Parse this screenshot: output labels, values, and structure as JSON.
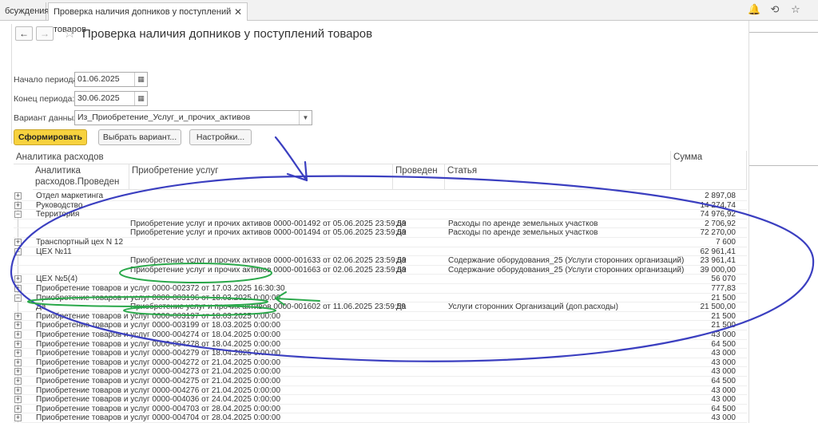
{
  "tabs": [
    {
      "label": "бсуждения"
    },
    {
      "label": "Проверка наличия допников у поступлений товаров"
    }
  ],
  "icons": {
    "bell": "bell-icon",
    "history": "history-icon",
    "star": "star-icon",
    "close": "close-icon"
  },
  "nav": {
    "back": "←",
    "forward": "→"
  },
  "page_title": "Проверка наличия допников у поступлений товаров",
  "form": {
    "start_label": "Начало периода:",
    "start_value": "01.06.2025",
    "end_label": "Конец периода:",
    "end_value": "30.06.2025",
    "variant_label": "Вариант данных:",
    "variant_value": "Из_Приобретение_Услуг_и_прочих_активов"
  },
  "buttons": {
    "generate": "Сформировать",
    "choose_variant": "Выбрать вариант...",
    "settings": "Настройки..."
  },
  "report": {
    "headers": {
      "group": "Аналитика расходов",
      "sum": "Сумма",
      "col0": "Аналитика расходов.Проведен",
      "col1": "Приобретение услуг",
      "col2": "Проведен",
      "col3": "Статья"
    },
    "rows": [
      {
        "exp": "+",
        "c0": "Отдел маркетинга",
        "c1": "",
        "c2": "",
        "c3": "",
        "sum": "2 897,08"
      },
      {
        "exp": "+",
        "c0": "Руководство",
        "c1": "",
        "c2": "",
        "c3": "",
        "sum": "14 274,74"
      },
      {
        "exp": "−",
        "c0": "Территория",
        "c1": "",
        "c2": "",
        "c3": "",
        "sum": "74 976,92"
      },
      {
        "exp": "",
        "c0": "",
        "c1": "Приобретение услуг и прочих активов 0000-001492 от 05.06.2025 23:59:59",
        "c2": "Да",
        "c3": "Расходы по аренде земельных участков",
        "sum": "2 706,92"
      },
      {
        "exp": "",
        "c0": "",
        "c1": "Приобретение услуг и прочих активов 0000-001494 от 05.06.2025 23:59:59",
        "c2": "Да",
        "c3": "Расходы по аренде земельных участков",
        "sum": "72 270,00"
      },
      {
        "exp": "+",
        "c0": "Транспортный цех N 12",
        "c1": "",
        "c2": "",
        "c3": "",
        "sum": "7 600"
      },
      {
        "exp": "−",
        "c0": "ЦЕХ №11",
        "c1": "",
        "c2": "",
        "c3": "",
        "sum": "62 961,41"
      },
      {
        "exp": "",
        "c0": "",
        "c1": "Приобретение услуг и прочих активов 0000-001633 от 02.06.2025 23:59:59",
        "c2": "Да",
        "c3": "Содержание оборудования_25 (Услуги сторонних организаций)",
        "sum": "23 961,41"
      },
      {
        "exp": "",
        "c0": "",
        "c1": "Приобретение услуг и прочих активов 0000-001663 от 02.06.2025 23:59:59",
        "c2": "Да",
        "c3": "Содержание оборудования_25 (Услуги сторонних организаций)",
        "sum": "39 000,00"
      },
      {
        "exp": "+",
        "c0": "ЦЕХ №5(4)",
        "c1": "",
        "c2": "",
        "c3": "",
        "sum": "56 070"
      },
      {
        "exp": "+",
        "c0": "Приобретение товаров и услуг 0000-002372 от 17.03.2025 16:30:30",
        "c1": "",
        "c2": "",
        "c3": "",
        "sum": "777,83"
      },
      {
        "exp": "−",
        "c0": "Приобретение товаров и услуг 0000-003196 от 18.03.2025 0:00:00",
        "c1": "",
        "c2": "",
        "c3": "",
        "sum": "21 500"
      },
      {
        "exp": "",
        "c0": "Да",
        "c1": "Приобретение услуг и прочих активов 0000-001602 от 11.06.2025 23:59:59",
        "c2": "Да",
        "c3": "Услуги сторонних Организаций (доп.расходы)",
        "sum": "21 500,00"
      },
      {
        "exp": "+",
        "c0": "Приобретение товаров и услуг 0000-003197 от 18.03.2025 0:00:00",
        "c1": "",
        "c2": "",
        "c3": "",
        "sum": "21 500"
      },
      {
        "exp": "+",
        "c0": "Приобретение товаров и услуг 0000-003199 от 18.03.2025 0:00:00",
        "c1": "",
        "c2": "",
        "c3": "",
        "sum": "21 500"
      },
      {
        "exp": "+",
        "c0": "Приобретение товаров и услуг 0000-004274 от 18.04.2025 0:00:00",
        "c1": "",
        "c2": "",
        "c3": "",
        "sum": "43 000"
      },
      {
        "exp": "+",
        "c0": "Приобретение товаров и услуг 0000-004278 от 18.04.2025 0:00:00",
        "c1": "",
        "c2": "",
        "c3": "",
        "sum": "64 500"
      },
      {
        "exp": "+",
        "c0": "Приобретение товаров и услуг 0000-004279 от 18.04.2025 0:00:00",
        "c1": "",
        "c2": "",
        "c3": "",
        "sum": "43 000"
      },
      {
        "exp": "+",
        "c0": "Приобретение товаров и услуг 0000-004272 от 21.04.2025 0:00:00",
        "c1": "",
        "c2": "",
        "c3": "",
        "sum": "43 000"
      },
      {
        "exp": "+",
        "c0": "Приобретение товаров и услуг 0000-004273 от 21.04.2025 0:00:00",
        "c1": "",
        "c2": "",
        "c3": "",
        "sum": "43 000"
      },
      {
        "exp": "+",
        "c0": "Приобретение товаров и услуг 0000-004275 от 21.04.2025 0:00:00",
        "c1": "",
        "c2": "",
        "c3": "",
        "sum": "64 500"
      },
      {
        "exp": "+",
        "c0": "Приобретение товаров и услуг 0000-004276 от 21.04.2025 0:00:00",
        "c1": "",
        "c2": "",
        "c3": "",
        "sum": "43 000"
      },
      {
        "exp": "+",
        "c0": "Приобретение товаров и услуг 0000-004036 от 24.04.2025 0:00:00",
        "c1": "",
        "c2": "",
        "c3": "",
        "sum": "43 000"
      },
      {
        "exp": "+",
        "c0": "Приобретение товаров и услуг 0000-004703 от 28.04.2025 0:00:00",
        "c1": "",
        "c2": "",
        "c3": "",
        "sum": "64 500"
      },
      {
        "exp": "+",
        "c0": "Приобретение товаров и услуг 0000-004704 от 28.04.2025 0:00:00",
        "c1": "",
        "c2": "",
        "c3": "",
        "sum": "43 000"
      }
    ]
  },
  "annotation_colors": {
    "arrow_ellipse": "#3b3fc0",
    "highlights": "#2aa84a"
  }
}
